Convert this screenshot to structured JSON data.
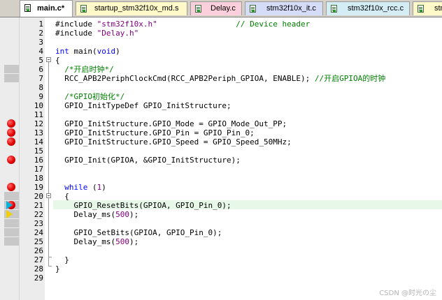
{
  "tabs": [
    {
      "label": "main.c*",
      "active": true
    },
    {
      "label": "startup_stm32f10x_md.s",
      "active": false
    },
    {
      "label": "Delay.c",
      "active": false
    },
    {
      "label": "stm32f10x_it.c",
      "active": false
    },
    {
      "label": "stm32f10x_rcc.c",
      "active": false
    },
    {
      "label": "stm3",
      "active": false
    }
  ],
  "code_lines": [
    {
      "n": "1",
      "text": "#include \"stm32f10x.h\"                 // Device header"
    },
    {
      "n": "2",
      "text": "#include \"Delay.h\""
    },
    {
      "n": "3",
      "text": ""
    },
    {
      "n": "4",
      "text": "int main(void)"
    },
    {
      "n": "5",
      "text": "{"
    },
    {
      "n": "6",
      "text": "  /*开启时钟*/"
    },
    {
      "n": "7",
      "text": "  RCC_APB2PeriphClockCmd(RCC_APB2Periph_GPIOA, ENABLE); //开启GPIOA的时钟"
    },
    {
      "n": "8",
      "text": ""
    },
    {
      "n": "9",
      "text": "  /*GPIO初始化*/"
    },
    {
      "n": "10",
      "text": "  GPIO_InitTypeDef GPIO_InitStructure;"
    },
    {
      "n": "11",
      "text": ""
    },
    {
      "n": "12",
      "text": "  GPIO_InitStructure.GPIO_Mode = GPIO_Mode_Out_PP;"
    },
    {
      "n": "13",
      "text": "  GPIO_InitStructure.GPIO_Pin = GPIO_Pin_0;"
    },
    {
      "n": "14",
      "text": "  GPIO_InitStructure.GPIO_Speed = GPIO_Speed_50MHz;"
    },
    {
      "n": "15",
      "text": ""
    },
    {
      "n": "16",
      "text": "  GPIO_Init(GPIOA, &GPIO_InitStructure);"
    },
    {
      "n": "17",
      "text": ""
    },
    {
      "n": "18",
      "text": ""
    },
    {
      "n": "19",
      "text": "  while (1)"
    },
    {
      "n": "20",
      "text": "  {"
    },
    {
      "n": "21",
      "text": "    GPIO_ResetBits(GPIOA, GPIO_Pin_0);"
    },
    {
      "n": "22",
      "text": "    Delay_ms(500);"
    },
    {
      "n": "23",
      "text": ""
    },
    {
      "n": "24",
      "text": "    GPIO_SetBits(GPIOA, GPIO_Pin_0);"
    },
    {
      "n": "25",
      "text": "    Delay_ms(500);"
    },
    {
      "n": "26",
      "text": ""
    },
    {
      "n": "27",
      "text": "  }"
    },
    {
      "n": "28",
      "text": "}"
    },
    {
      "n": "29",
      "text": ""
    }
  ],
  "breakpoint_lines": [
    12,
    13,
    14,
    16,
    19,
    21
  ],
  "grey_marker_lines": [
    6,
    7,
    20,
    21,
    22,
    23,
    24,
    25
  ],
  "current_line": 21,
  "next_line": 22,
  "watermark": "CSDN @时光の尘",
  "colors": {
    "keyword": "#0000ff",
    "string": "#800080",
    "comment": "#008000",
    "number": "#800080",
    "breakpoint": "#e00000",
    "current_line_highlight": "#e8f8e8"
  },
  "icons": {
    "tab_file": "document-icon",
    "breakpoint": "breakpoint-icon",
    "execution_pointer": "current-line-arrow-icon"
  }
}
